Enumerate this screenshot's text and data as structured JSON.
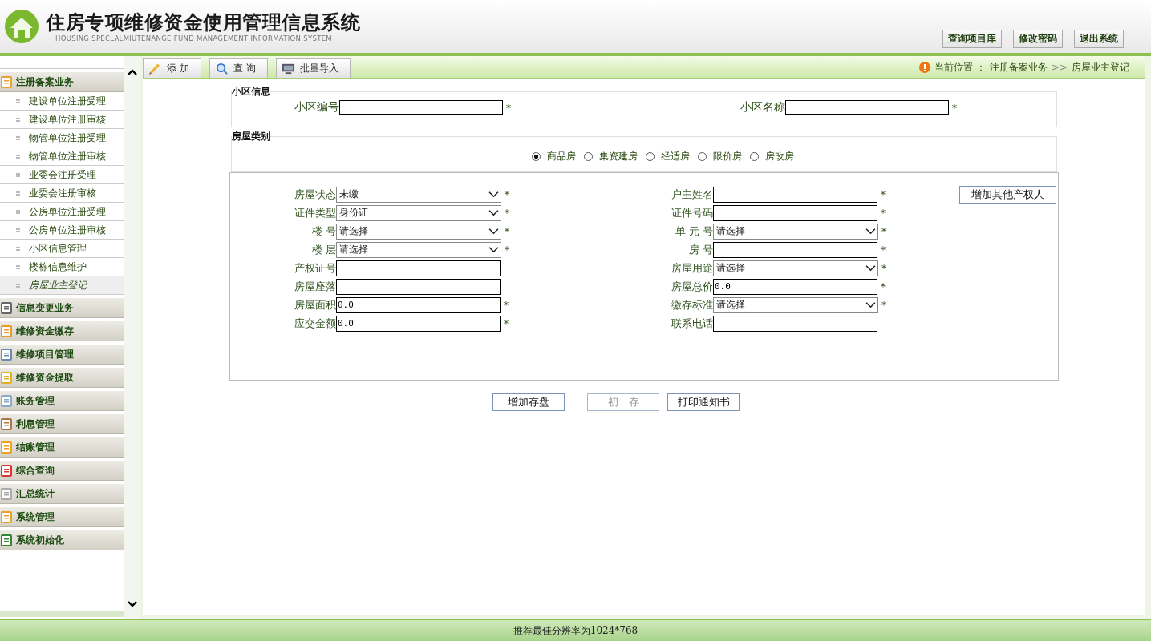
{
  "header": {
    "title": "住房专项维修资金使用管理信息系统",
    "subtitle": "HOUSING SPECLALMIUTENANGE FUND MANAGEMENT INFORMATION SYSTEM",
    "buttons": [
      "查询项目库",
      "修改密码",
      "退出系统"
    ]
  },
  "toolbar": {
    "buttons": [
      "添 加",
      "查 询",
      "批量导入"
    ],
    "breadcrumb": {
      "label": "当前位置 ：",
      "path": [
        "注册备案业务",
        "房屋业主登记"
      ],
      "separator": ">>"
    }
  },
  "sidebar": {
    "groups": [
      {
        "label": "注册备案业务",
        "items": [
          {
            "label": "建设单位注册受理",
            "selected": false
          },
          {
            "label": "建设单位注册审核",
            "selected": false
          },
          {
            "label": "物管单位注册受理",
            "selected": false
          },
          {
            "label": "物管单位注册审核",
            "selected": false
          },
          {
            "label": "业委会注册受理",
            "selected": false
          },
          {
            "label": "业委会注册审核",
            "selected": false
          },
          {
            "label": "公房单位注册受理",
            "selected": false
          },
          {
            "label": "公房单位注册审核",
            "selected": false
          },
          {
            "label": "小区信息管理",
            "selected": false
          },
          {
            "label": "楼栋信息维护",
            "selected": false
          },
          {
            "label": "房屋业主登记",
            "selected": true
          }
        ]
      },
      {
        "label": "信息变更业务"
      },
      {
        "label": "维修资金缴存"
      },
      {
        "label": "维修项目管理"
      },
      {
        "label": "维修资金提取"
      },
      {
        "label": "账务管理"
      },
      {
        "label": "利息管理"
      },
      {
        "label": "结账管理"
      },
      {
        "label": "综合查询"
      },
      {
        "label": "汇总统计"
      },
      {
        "label": "系统管理"
      },
      {
        "label": "系统初始化"
      }
    ]
  },
  "form": {
    "community": {
      "legend": "小区信息",
      "fields": [
        {
          "label": "小区编号",
          "mark": "*"
        },
        {
          "label": "小区名称",
          "mark": "*"
        }
      ]
    },
    "house_type": {
      "legend": "房屋类别",
      "options": [
        {
          "label": "商品房",
          "selected": true
        },
        {
          "label": "集资建房",
          "selected": false
        },
        {
          "label": "经适房",
          "selected": false
        },
        {
          "label": "限价房",
          "selected": false
        },
        {
          "label": "房改房",
          "selected": false
        }
      ]
    },
    "details": {
      "fields": [
        {
          "label": "房屋状态",
          "kind": "select",
          "value": "未缴",
          "mark": "*"
        },
        {
          "label": "户主姓名",
          "kind": "text",
          "mark": "*"
        },
        {
          "label": "证件类型",
          "kind": "select",
          "value": "身份证",
          "mark": "*"
        },
        {
          "label": "证件号码",
          "kind": "text",
          "mark": "*"
        },
        {
          "label": "楼 号",
          "kind": "select",
          "value": "请选择",
          "mark": "*"
        },
        {
          "label": "单 元 号",
          "kind": "select",
          "value": "请选择",
          "mark": "*"
        },
        {
          "label": "楼 层",
          "kind": "select",
          "value": "请选择",
          "mark": "*"
        },
        {
          "label": "房 号",
          "kind": "text",
          "mark": "*"
        },
        {
          "label": "产权证号",
          "kind": "text"
        },
        {
          "label": "房屋用途",
          "kind": "select",
          "value": "请选择",
          "mark": "*"
        },
        {
          "label": "房屋座落",
          "kind": "text"
        },
        {
          "label": "房屋总价",
          "kind": "text",
          "value": "0.0",
          "mark": "*"
        },
        {
          "label": "房屋面积",
          "kind": "text",
          "value": "0.0",
          "mark": "*"
        },
        {
          "label": "缴存标准",
          "kind": "select",
          "value": "请选择",
          "mark": "*"
        },
        {
          "label": "应交金额",
          "kind": "text",
          "value": "0.0",
          "mark": "*"
        },
        {
          "label": "联系电话",
          "kind": "text"
        }
      ],
      "add_owner_button": "增加其他产权人"
    },
    "actions": [
      {
        "label": "增加存盘",
        "disabled": false
      },
      {
        "label": "初　存",
        "disabled": true
      },
      {
        "label": "打印通知书",
        "disabled": false
      }
    ]
  },
  "footer": "推荐最佳分辨率为1024*768"
}
